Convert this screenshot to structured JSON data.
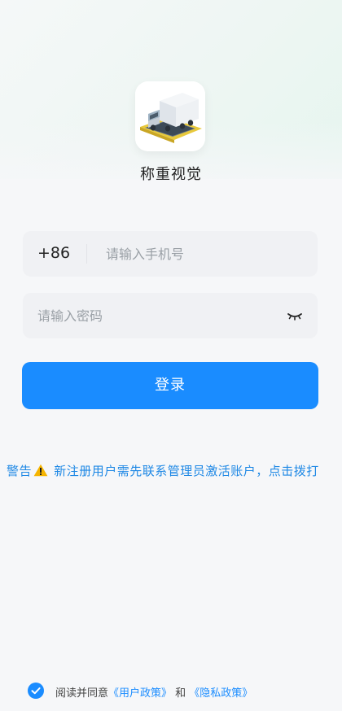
{
  "app": {
    "name": "称重视觉",
    "logo_icon": "truck-on-scale-icon"
  },
  "login_form": {
    "country_code": "+86",
    "phone_placeholder": "请输入手机号",
    "password_placeholder": "请输入密码",
    "password_toggle_icon": "eye-closed-icon",
    "submit_label": "登录"
  },
  "notice": {
    "prefix": "警告",
    "icon": "warning-icon",
    "message": " 新注册用户需先联系管理员激活账户，点击拨打"
  },
  "agreement": {
    "checked": true,
    "text": "阅读并同意",
    "user_policy": "《用户政策》",
    "and": " 和 ",
    "privacy_policy": "《隐私政策》"
  },
  "colors": {
    "accent": "#1a8cff",
    "notice": "#1e88e5",
    "warning_icon": "#f5b400"
  }
}
